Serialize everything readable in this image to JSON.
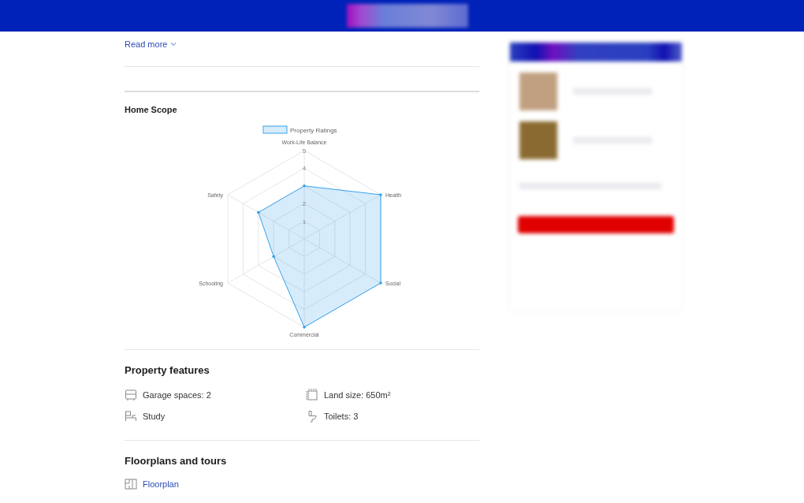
{
  "description": {
    "read_more": "Read more"
  },
  "home_scope": {
    "title": "Home Scope",
    "chart_data": {
      "type": "radar",
      "categories": [
        "Work-Life Balance",
        "Health",
        "Social",
        "Commercial",
        "Schooling",
        "Safety"
      ],
      "series": [
        {
          "name": "Property Ratings",
          "color": "#36a2eb",
          "values": [
            3,
            5,
            5,
            5,
            2,
            3
          ]
        }
      ],
      "ylim": [
        0,
        5
      ],
      "yticks": [
        1,
        2,
        4,
        5
      ]
    }
  },
  "property_features": {
    "title": "Property features",
    "items": [
      {
        "label": "Garage spaces: 2"
      },
      {
        "label": "Land size: 650m²"
      },
      {
        "label": "Study"
      },
      {
        "label": "Toilets: 3"
      }
    ]
  },
  "floorplans": {
    "title": "Floorplans and tours",
    "links": [
      {
        "label": "Floorplan"
      }
    ]
  }
}
